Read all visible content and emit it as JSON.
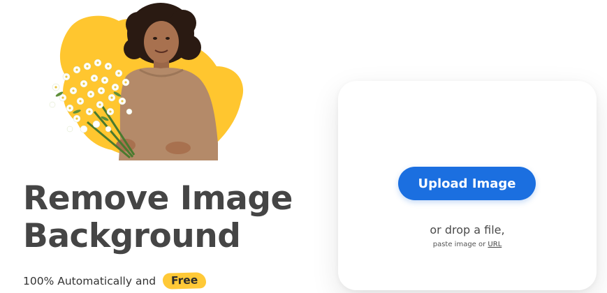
{
  "hero": {
    "title_line1": "Remove Image",
    "title_line2": "Background",
    "subtitle_prefix": "100% Automatically and",
    "badge": "Free"
  },
  "upload_card": {
    "button_label": "Upload Image",
    "drop_text": "or drop a file,",
    "paste_prefix": "paste image or",
    "url_link": "URL"
  },
  "colors": {
    "accent_blue": "#1b6fe0",
    "accent_yellow": "#ffc937",
    "headline": "#454545"
  },
  "illustration": {
    "subject": "woman-holding-flowers-photo",
    "backdrop": "yellow-blob"
  }
}
